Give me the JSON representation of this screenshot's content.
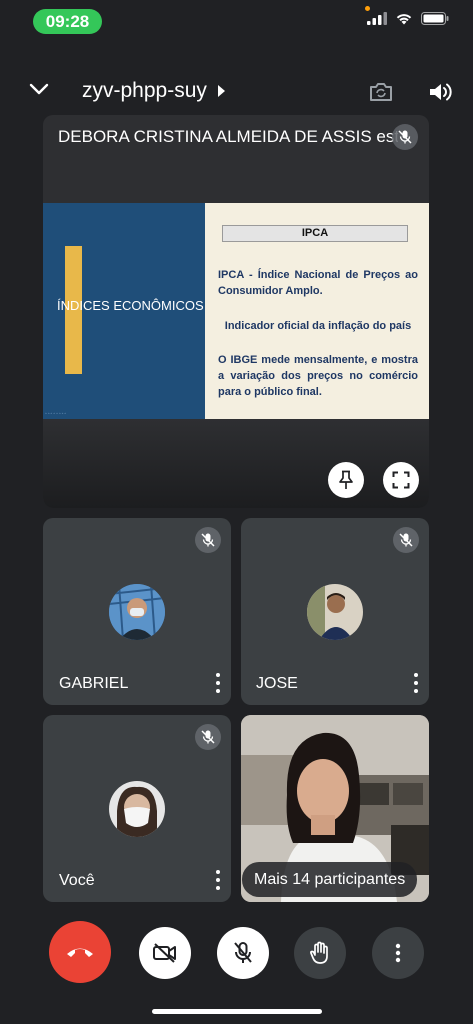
{
  "status_bar": {
    "time": "09:28",
    "icons": [
      "cellular-signal-icon",
      "wifi-icon",
      "battery-icon"
    ]
  },
  "meeting": {
    "code": "zyv-phpp-suy"
  },
  "main_tile": {
    "presenter_text": "DEBORA CRISTINA ALMEIDA DE ASSIS está apresentando",
    "slide": {
      "left_title": "ÍNDICES ECONÔMICOS",
      "heading": "IPCA",
      "paragraph_1": "IPCA - Índice Nacional de Preços ao Consumidor Amplo.",
      "paragraph_2": "Indicador oficial da inflação do país",
      "paragraph_3": "O IBGE mede mensalmente, e mostra a variação dos preços no comércio para o público final."
    }
  },
  "participants": [
    {
      "name": "GABRIEL",
      "muted": true
    },
    {
      "name": "JOSE",
      "muted": true
    },
    {
      "name": "Você",
      "muted": true
    }
  ],
  "more_participants_label": "Mais 14 participantes",
  "colors": {
    "background": "#202124",
    "tile": "#3c4043",
    "end_call": "#ea4335",
    "time_pill": "#34c759"
  }
}
